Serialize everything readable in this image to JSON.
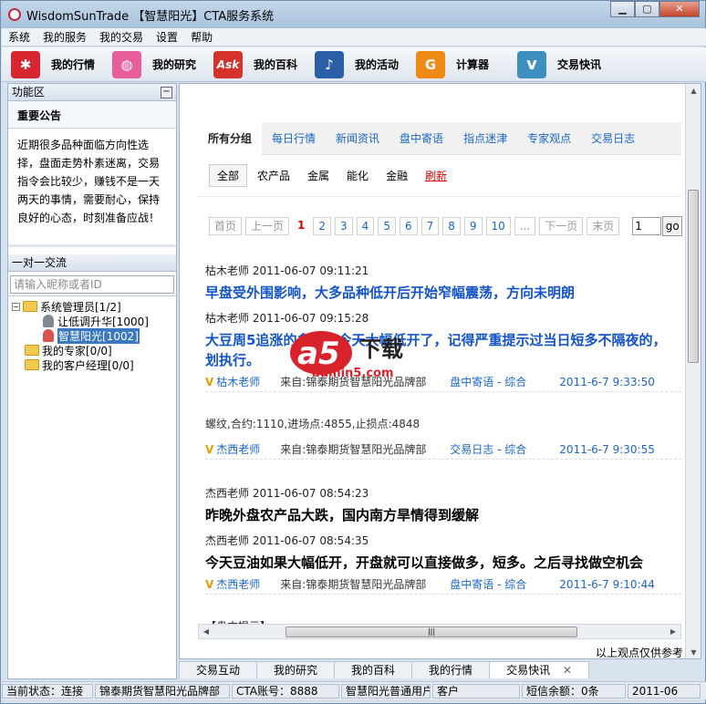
{
  "window": {
    "title": "WisdomSunTrade 【智慧阳光】CTA服务系统",
    "min": "▁",
    "max": "▢",
    "close": "✕"
  },
  "menu": [
    "系统",
    "我的服务",
    "我的交易",
    "设置",
    "帮助"
  ],
  "toolbar": [
    {
      "label": "我的行情",
      "icon": "yelp-icon",
      "glyph": "✱",
      "color": "#d7262f"
    },
    {
      "label": "我的研究",
      "icon": "dribbble-icon",
      "glyph": "◍",
      "color": "#e85d9b"
    },
    {
      "label": "我的百科",
      "icon": "ask-icon",
      "glyph": "Ask",
      "color": "#d4322a"
    },
    {
      "label": "我的活动",
      "icon": "music-icon",
      "glyph": "♪",
      "color": "#2a5fa8"
    },
    {
      "label": "计算器",
      "icon": "calculator-icon",
      "glyph": "G",
      "color": "#f08a16"
    },
    {
      "label": "交易快讯",
      "icon": "vimeo-icon",
      "glyph": "v",
      "color": "#3d8fbf"
    }
  ],
  "left": {
    "panel_title": "功能区",
    "notice_title": "重要公告",
    "notice_text": "近期很多品种面临方向性选择，盘面走势朴素迷离，交易指令会比较少，赚钱不是一天两天的事情，需要耐心，保持良好的心态，时刻准备应战！",
    "chat_title": "一对一交流",
    "search_placeholder": "请输入昵称或者ID",
    "tree": {
      "admins": "系统管理员[1/2]",
      "member1": "让低调升华[1000]",
      "member2": "智慧阳光[1002]",
      "experts": "我的专家[0/0]",
      "managers": "我的客户经理[0/0]"
    }
  },
  "categories": [
    "所有分组",
    "每日行情",
    "新闻资讯",
    "盘中寄语",
    "指点迷津",
    "专家观点",
    "交易日志"
  ],
  "subcategories": [
    "全部",
    "农产品",
    "金属",
    "能化",
    "金融",
    "刷新"
  ],
  "pager": {
    "first": "首页",
    "prev": "上一页",
    "pages": [
      "1",
      "2",
      "3",
      "4",
      "5",
      "6",
      "7",
      "8",
      "9",
      "10"
    ],
    "ellipsis": "...",
    "next": "下一页",
    "last": "末页",
    "input": "1",
    "go": "go"
  },
  "posts": [
    {
      "meta1": "枯木老师  2011-06-07 09:11:21",
      "title1": "早盘受外围影响，大多品种低开后开始窄幅震荡，方向未明朗",
      "meta2": "枯木老师  2011-06-07 09:15:28",
      "title2a": "大豆周5追涨的多单，今天大幅低开了，记得严重提示过当日短多不隔夜的，",
      "title2b": "划执行。",
      "author": "枯木老师",
      "from": "来自:锦泰期货智慧阳光品牌部",
      "cat": "盘中寄语  - 综合",
      "time": "2011-6-7 9:33:50"
    },
    {
      "plain": "螺纹,合约:1110,进场点:4855,止损点:4848",
      "author": "杰西老师",
      "from": "来自:锦泰期货智慧阳光品牌部",
      "cat": "交易日志  - 综合",
      "time": "2011-6-7 9:30:55"
    },
    {
      "meta1": "杰西老师  2011-06-07 08:54:23",
      "title1": "昨晚外盘农产品大跌，国内南方旱情得到缓解",
      "meta2": "杰西老师  2011-06-07 08:54:35",
      "title2a": "今天豆油如果大幅低开，开盘就可以直接做多，短多。之后寻找做空机会",
      "author": "杰西老师",
      "from": "来自:锦泰期货智慧阳光品牌部",
      "cat": "盘中寄语  - 综合",
      "time": "2011-6-7 9:10:44"
    }
  ],
  "cutoff": "【盘中提示】",
  "watermark": {
    "a5": "a5",
    "xiazai": "下载",
    "site": "admin5.com"
  },
  "bottom_note": "以上观点仅供参考",
  "bottom_tabs": [
    "交易互动",
    "我的研究",
    "我的百科",
    "我的行情",
    "交易快讯"
  ],
  "close_tab": "✕",
  "status": [
    "当前状态：连接",
    "锦泰期货智慧阳光品牌部",
    "CTA账号：8888",
    "智慧阳光普通用户",
    "客户",
    "短信余额：0条",
    "2011-06"
  ]
}
